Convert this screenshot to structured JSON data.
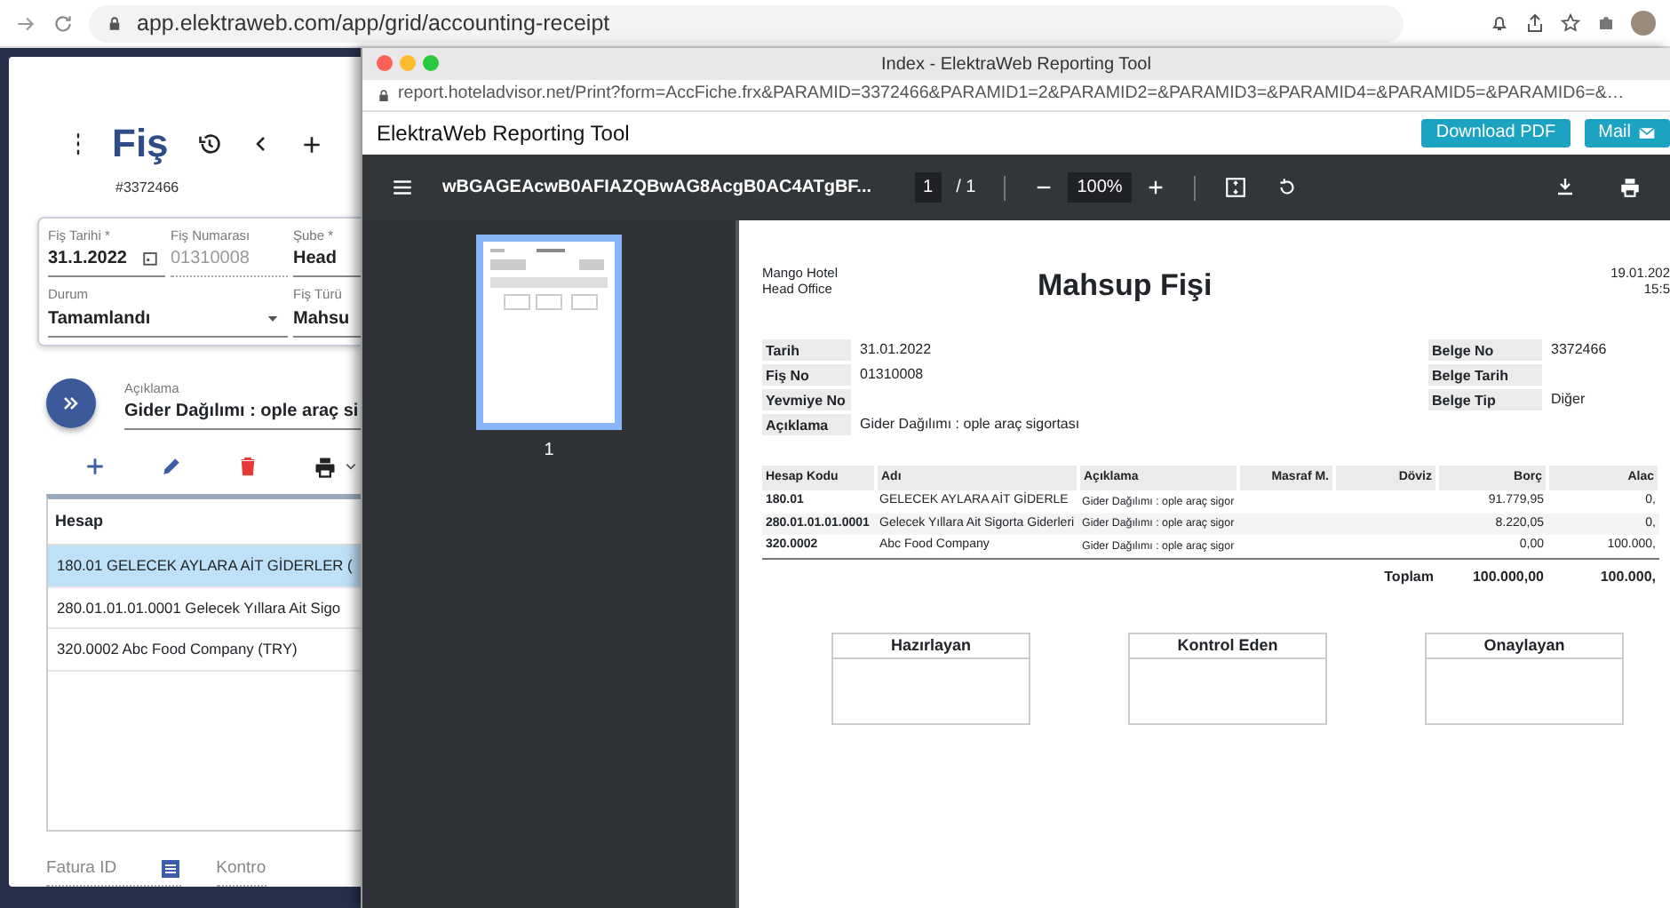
{
  "browser": {
    "url": "app.elektraweb.com/app/grid/accounting-receipt"
  },
  "app": {
    "title": "Fiş",
    "record_no": "#3372466",
    "fields": [
      {
        "label": "Fiş Tarihi *",
        "value": "31.1.2022",
        "kind": "date",
        "disabled": false
      },
      {
        "label": "Fiş Numarası",
        "value": "01310008",
        "kind": "text",
        "disabled": true
      },
      {
        "label": "Şube *",
        "value": "Head",
        "kind": "text",
        "disabled": false
      },
      {
        "label": "Durum",
        "value": "Tamamlandı",
        "kind": "select",
        "disabled": false
      },
      {
        "label": "Fiş Türü",
        "value": "Mahsu",
        "kind": "text",
        "disabled": false
      }
    ],
    "description": {
      "label": "Açıklama",
      "value": "Gider Dağılımı : ople araç si"
    },
    "grid": {
      "columns": [
        "Hesap"
      ],
      "rows": [
        {
          "cells": [
            "180.01 GELECEK AYLARA AİT GİDERLER ("
          ],
          "selected": true
        },
        {
          "cells": [
            "280.01.01.01.0001 Gelecek Yıllara Ait Sigo"
          ],
          "selected": false
        },
        {
          "cells": [
            "320.0002 Abc Food Company (TRY)"
          ],
          "selected": false
        }
      ]
    },
    "footer_fields": [
      {
        "label": "Fatura ID",
        "kind": "lookup"
      },
      {
        "label": "Kontro",
        "kind": "text"
      }
    ]
  },
  "popup": {
    "title": "Index - ElektraWeb Reporting Tool",
    "url": "report.hoteladvisor.net/Print?form=AccFiche.frx&PARAMID=3372466&PARAMID1=2&PARAMID2=&PARAMID3=&PARAMID4=&PARAMID5=&PARAMID6=&…",
    "header": "ElektraWeb Reporting Tool",
    "buttons": [
      {
        "label": "Download PDF",
        "kind": "plain"
      },
      {
        "label": "Mail",
        "kind": "mail"
      }
    ],
    "viewer": {
      "file_name": "wBGAGEAcwB0AFIAZQBwAG8AcgB0AC4ATgBF...",
      "page": "1",
      "page_count": "/ 1",
      "zoom": "100%",
      "thumbnails": [
        {
          "label": "1",
          "selected": true
        }
      ]
    },
    "document": {
      "company": [
        "Mango Hotel",
        "Head Office"
      ],
      "title": "Mahsup Fişi",
      "printed": [
        "19.01.202",
        "15:5"
      ],
      "info_left": [
        {
          "label": "Tarih",
          "value": "31.01.2022"
        },
        {
          "label": "Fiş No",
          "value": "01310008"
        },
        {
          "label": "Yevmiye No"
        },
        {
          "label": "Açıklama",
          "value": "Gider Dağılımı : ople araç sigortası"
        }
      ],
      "info_right": [
        {
          "label": "Belge No",
          "value": "3372466"
        },
        {
          "label": "Belge Tarih"
        },
        {
          "label": "Belge Tip",
          "value": "Diğer"
        }
      ],
      "table": {
        "columns": [
          "Hesap Kodu",
          "Adı",
          "Açıklama",
          "Masraf M.",
          "Döviz",
          "Borç",
          "Alac"
        ],
        "rows": [
          [
            "180.01",
            "GELECEK AYLARA AİT GİDERLE",
            "Gider Dağılımı : ople araç sigor",
            "",
            "",
            "91.779,95",
            "0,"
          ],
          [
            "280.01.01.01.0001",
            "Gelecek Yıllara Ait Sigorta Giderleri",
            "Gider Dağılımı : ople araç sigor",
            "",
            "",
            "8.220,05",
            "0,"
          ],
          [
            "320.0002",
            "Abc Food Company",
            "Gider Dağılımı : ople araç sigor",
            "",
            "",
            "0,00",
            "100.000,"
          ]
        ],
        "total": {
          "label": "Toplam",
          "values": [
            "100.000,00",
            "100.000,"
          ]
        }
      },
      "signatures": [
        "Hazırlayan",
        "Kontrol Eden",
        "Onaylayan"
      ]
    }
  }
}
